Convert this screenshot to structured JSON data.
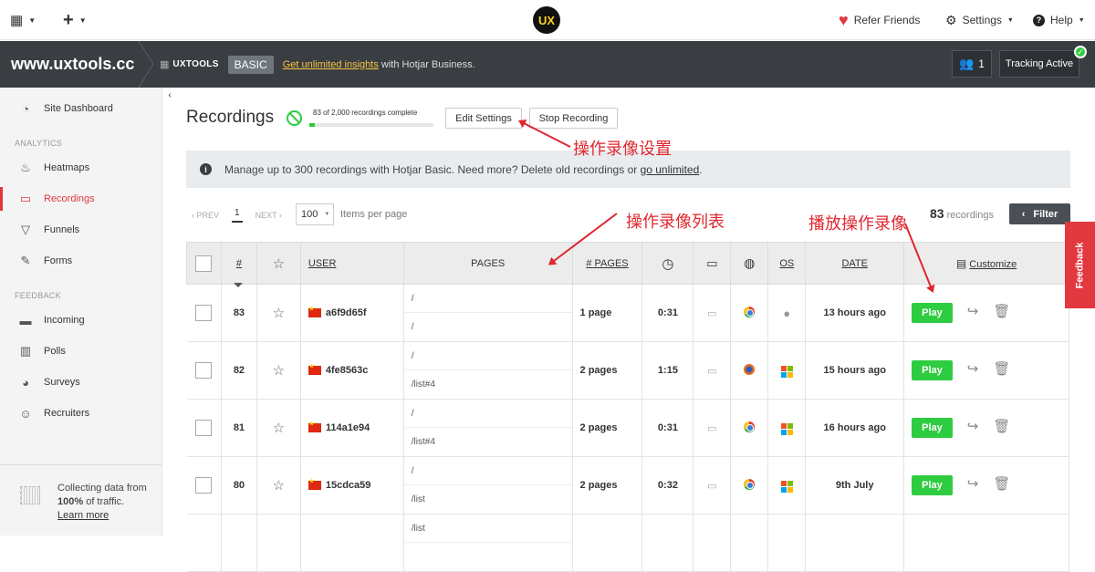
{
  "topbar": {
    "logo": "UX",
    "refer": "Refer Friends",
    "settings": "Settings",
    "help": "Help"
  },
  "site": {
    "url": "www.uxtools.cc",
    "org": "UXTOOLS",
    "plan": "BASIC",
    "upsell_link": "Get unlimited insights",
    "upsell_rest": " with Hotjar Business.",
    "users_count": "1",
    "tracking": "Tracking Active"
  },
  "sidebar": {
    "dashboard": "Site Dashboard",
    "analytics_head": "ANALYTICS",
    "analytics": [
      "Heatmaps",
      "Recordings",
      "Funnels",
      "Forms"
    ],
    "feedback_head": "FEEDBACK",
    "feedback": [
      "Incoming",
      "Polls",
      "Surveys",
      "Recruiters"
    ],
    "collect_line1": "Collecting data from",
    "collect_pct": "100%",
    "collect_line2": " of traffic.",
    "learn_more": "Learn more"
  },
  "page": {
    "title": "Recordings",
    "progress_label": "83 of 2,000 recordings complete",
    "progress_fraction": 0.0415,
    "edit_settings": "Edit Settings",
    "stop_recording": "Stop Recording"
  },
  "info": {
    "text": "Manage up to 300 recordings with Hotjar Basic. Need more? Delete old recordings or ",
    "link": "go unlimited",
    "end": "."
  },
  "pager": {
    "prev": "‹ PREV",
    "current": "1",
    "next": "NEXT ›",
    "per_page": "100",
    "per_page_label": "Items per page",
    "count": "83",
    "count_label": " recordings",
    "filter": "Filter"
  },
  "table": {
    "headers": {
      "num": "#",
      "user": "USER",
      "pages": "PAGES",
      "num_pages": "# PAGES",
      "os": "OS",
      "date": "DATE",
      "customize": "Customize"
    },
    "play_label": "Play",
    "rows": [
      {
        "num": "83",
        "user": "a6f9d65f",
        "pages": [
          "/",
          "/"
        ],
        "num_pages": "1 page",
        "duration": "0:31",
        "browser": "chrome",
        "os": "apple",
        "date": "13 hours ago"
      },
      {
        "num": "82",
        "user": "4fe8563c",
        "pages": [
          "/",
          "/list#4"
        ],
        "num_pages": "2 pages",
        "duration": "1:15",
        "browser": "firefox",
        "os": "windows",
        "date": "15 hours ago"
      },
      {
        "num": "81",
        "user": "114a1e94",
        "pages": [
          "/",
          "/list#4"
        ],
        "num_pages": "2 pages",
        "duration": "0:31",
        "browser": "chrome",
        "os": "windows",
        "date": "16 hours ago"
      },
      {
        "num": "80",
        "user": "15cdca59",
        "pages": [
          "/",
          "/list"
        ],
        "num_pages": "2 pages",
        "duration": "0:32",
        "browser": "chrome",
        "os": "windows",
        "date": "9th July"
      },
      {
        "num": "",
        "user": "",
        "pages": [
          "/list",
          ""
        ],
        "num_pages": "",
        "duration": "",
        "browser": "",
        "os": "",
        "date": ""
      }
    ]
  },
  "annotations": {
    "settings": "操作录像设置",
    "list": "操作录像列表",
    "play": "播放操作录像"
  },
  "feedback_tab": "Feedback"
}
